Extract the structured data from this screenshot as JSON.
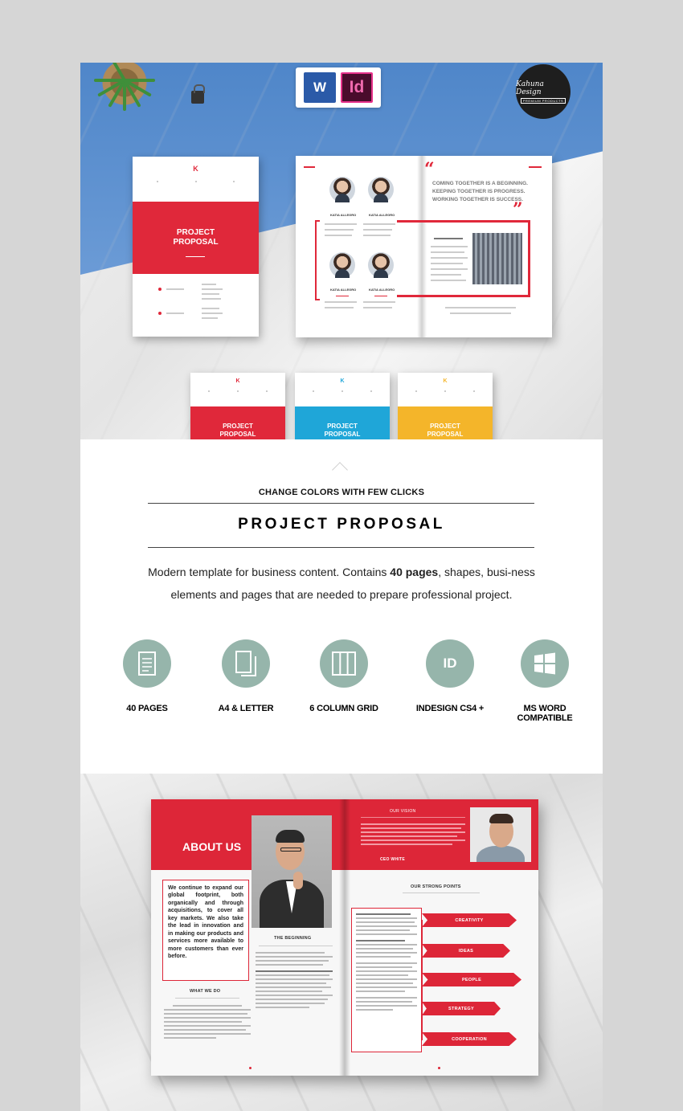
{
  "hero": {
    "app_badges": {
      "word_letter": "W",
      "indesign_letters": "Id"
    },
    "brand_logo": {
      "name": "Kahuna Design",
      "tagline": "PREMIUM PRODUCTS"
    },
    "main_cover": {
      "logo_letter": "K",
      "title_line1": "PROJECT",
      "title_line2": "PROPOSAL"
    },
    "quote": {
      "line1": "COMING TOGETHER IS A BEGINNING.",
      "line2": "KEEPING TOGETHER IS PROGRESS.",
      "line3": "WORKING TOGETHER IS SUCCESS."
    },
    "team_names": [
      "KATIA ALLEGRO",
      "KATIA ALLEGRO",
      "KATIA ALLEGRO",
      "KATIA ALLEGRO"
    ],
    "variant_covers": [
      {
        "logo_letter": "K",
        "title_line1": "PROJECT",
        "title_line2": "PROPOSAL",
        "color": "#e0283a"
      },
      {
        "logo_letter": "K",
        "title_line1": "PROJECT",
        "title_line2": "PROPOSAL",
        "color": "#1fa6d8"
      },
      {
        "logo_letter": "K",
        "title_line1": "PROJECT",
        "title_line2": "PROPOSAL",
        "color": "#f4b52a"
      }
    ]
  },
  "info": {
    "subtitle": "CHANGE  COLORS WITH FEW CLICKS",
    "title": "PROJECT PROPOSAL",
    "description": {
      "part1": "Modern template for business content. Contains ",
      "bold": "40 pages",
      "part2": ", shapes, busi-ness elements and pages that are needed to prepare professional project."
    },
    "features": [
      {
        "icon": "document-icon",
        "label": "40 PAGES"
      },
      {
        "icon": "pages-icon",
        "label": "A4 & LETTER"
      },
      {
        "icon": "grid-columns-icon",
        "label": "6 COLUMN GRID"
      },
      {
        "icon": "indesign-icon",
        "icon_text": "ID",
        "label": "INDESIGN CS4 +"
      },
      {
        "icon": "windows-icon",
        "label_line1": "MS WORD",
        "label_line2": "COMPATIBLE"
      }
    ],
    "accent_color": "#96b5ab"
  },
  "bottom_spread": {
    "about_title": "ABOUT US",
    "about_text": "We continue to expand our global footprint, both organically and through acquisitions, to cover all key markets. We also take the lead in innovation and in making our products and services more available to more customers than ever before.",
    "what_we_do": "WHAT WE DO",
    "the_beginning": "THE BEGINNING",
    "our_vision": "OUR VISION",
    "ceo_white": "CEO WHITE",
    "strong_points_title": "OUR STRONG POINTS",
    "strong_points": [
      "CREATIVITY",
      "IDEAS",
      "PEOPLE",
      "STRATEGY",
      "COOPERATION"
    ],
    "accent_color": "#dd2638"
  }
}
